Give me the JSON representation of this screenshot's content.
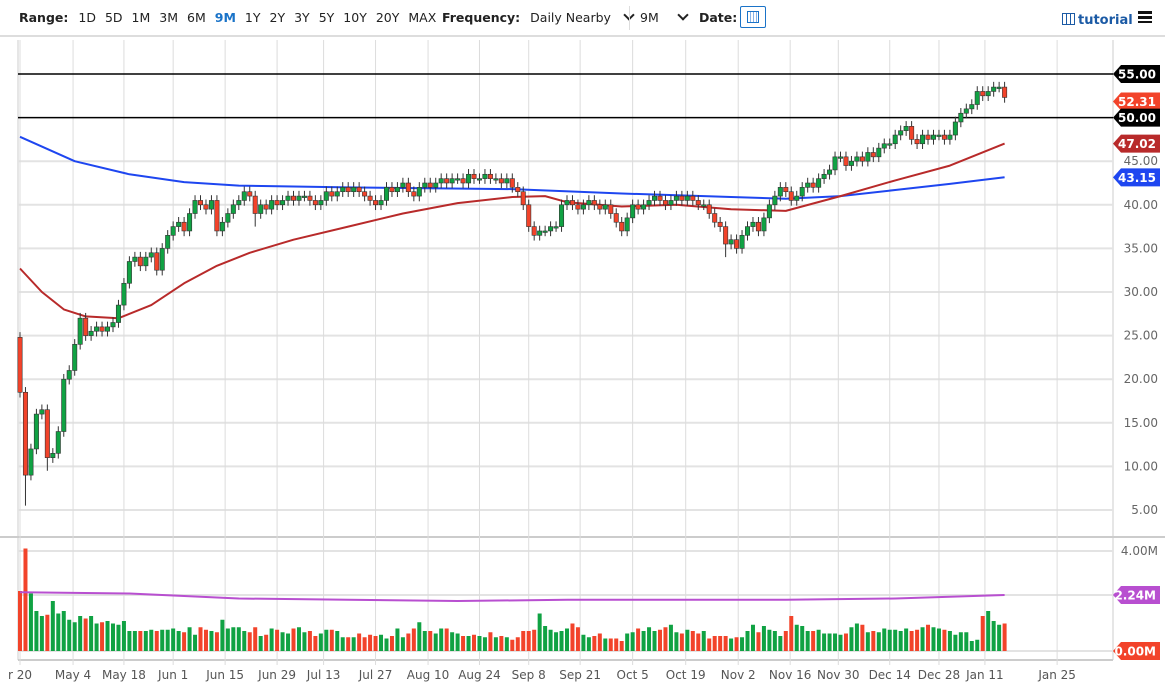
{
  "toolbar": {
    "range_label": "Range:",
    "ranges": [
      "1D",
      "5D",
      "1M",
      "3M",
      "6M",
      "9M",
      "1Y",
      "2Y",
      "3Y",
      "5Y",
      "10Y",
      "20Y",
      "MAX"
    ],
    "active_range": "9M",
    "frequency_label": "Frequency:",
    "frequency_value": "Daily Nearby",
    "period_value": "9M",
    "date_label": "Date:",
    "tutorial_label": "tutorial",
    "icons": {
      "calendar": "calendar-icon",
      "tutorial": "film-icon",
      "menu": "hamburger-menu-icon"
    }
  },
  "colors": {
    "up": "#10a243",
    "down": "#f2432a",
    "ma50": "#b82a2a",
    "ma200": "#1e46f0",
    "vol_ma": "#b84fd0",
    "level": "#000000",
    "last": "#f2432a"
  },
  "chart_data": {
    "type": "candlestick",
    "price_axis": {
      "range": [
        3,
        58
      ],
      "ticks": [
        5,
        10,
        15,
        20,
        25,
        30,
        35,
        40,
        45
      ],
      "grid": true
    },
    "volume_axis": {
      "range": [
        0,
        4.5
      ],
      "ticks": [
        "4.00M"
      ],
      "unit": "M"
    },
    "x_ticks": [
      {
        "label": "r 20",
        "index": 0
      },
      {
        "label": "May 4",
        "index": 9.7
      },
      {
        "label": "May 18",
        "index": 19
      },
      {
        "label": "Jun 1",
        "index": 28
      },
      {
        "label": "Jun 15",
        "index": 37.5
      },
      {
        "label": "Jun 29",
        "index": 47
      },
      {
        "label": "Jul 13",
        "index": 55.5
      },
      {
        "label": "Jul 27",
        "index": 65
      },
      {
        "label": "Aug 10",
        "index": 74.6
      },
      {
        "label": "Aug 24",
        "index": 84
      },
      {
        "label": "Sep 8",
        "index": 93
      },
      {
        "label": "Sep 21",
        "index": 102.4
      },
      {
        "label": "Oct 5",
        "index": 112
      },
      {
        "label": "Oct 19",
        "index": 121.7
      },
      {
        "label": "Nov 2",
        "index": 131.3
      },
      {
        "label": "Nov 16",
        "index": 140.8
      },
      {
        "label": "Nov 30",
        "index": 149.6
      },
      {
        "label": "Dec 14",
        "index": 159
      },
      {
        "label": "Dec 28",
        "index": 168
      },
      {
        "label": "Jan 11",
        "index": 176.4
      },
      {
        "label": "Jan 25",
        "index": 189.6
      }
    ],
    "first_open": 24.8,
    "close": [
      18.5,
      9,
      12,
      16,
      16.5,
      11,
      11.5,
      14,
      20,
      21,
      24,
      27,
      25,
      25.5,
      26,
      25.5,
      26,
      26.5,
      28.5,
      31,
      33.5,
      34,
      33,
      34,
      34.5,
      32.5,
      35,
      36.5,
      37.5,
      38,
      37,
      39,
      40.5,
      40,
      39.5,
      40.5,
      37,
      38,
      39,
      40,
      40.5,
      41.5,
      41,
      39,
      40,
      39.5,
      40.5,
      40,
      40.5,
      41,
      40.5,
      41,
      41,
      40.5,
      40,
      40.5,
      41.5,
      41,
      41.5,
      42,
      41.5,
      42,
      41.5,
      41,
      40.5,
      40,
      40.5,
      42,
      41.5,
      42,
      42.5,
      41.5,
      41,
      42,
      42.5,
      42,
      42.5,
      43,
      42.5,
      43,
      43,
      42.5,
      43.5,
      43,
      43,
      43.5,
      43,
      43,
      42.5,
      43,
      42,
      41.5,
      40,
      37.5,
      36.5,
      37,
      37,
      37.5,
      37.5,
      40,
      40.5,
      40,
      39.5,
      40,
      40.5,
      40,
      39.5,
      40,
      39,
      38,
      37,
      38.5,
      40,
      39.5,
      40,
      40.5,
      41,
      40.5,
      40,
      40.5,
      41,
      40.5,
      41,
      40.5,
      40,
      40,
      39,
      38,
      37.5,
      35.5,
      36,
      35,
      36.5,
      37.5,
      38,
      37,
      38.5,
      40,
      41,
      42,
      41.5,
      40.5,
      41,
      42,
      42.5,
      42,
      43,
      43.5,
      44,
      45.5,
      45.5,
      44.5,
      45,
      45.5,
      45,
      46,
      45.5,
      46.5,
      47,
      47,
      48,
      48.5,
      49,
      47.5,
      47,
      48,
      47.5,
      48,
      48,
      47.5,
      48,
      49.5,
      50.5,
      51,
      51.5,
      53,
      52.5,
      53,
      53.5,
      53.5,
      52.31
    ],
    "wick_pad": 0.6,
    "low_overrides": {
      "1": 5.5,
      "5": 9.5,
      "43": 37.5,
      "129": 34
    },
    "volume": [
      2.4,
      4.1,
      2.3,
      1.6,
      1.4,
      1.45,
      2.0,
      1.5,
      1.6,
      1.25,
      1.15,
      1.4,
      1.3,
      1.4,
      1.1,
      1.15,
      1.2,
      1.1,
      1.05,
      1.2,
      0.8,
      0.8,
      0.8,
      0.8,
      0.85,
      0.8,
      0.85,
      0.85,
      0.9,
      0.8,
      0.75,
      0.95,
      0.65,
      0.95,
      0.85,
      0.8,
      0.75,
      1.25,
      0.9,
      0.95,
      0.95,
      0.8,
      0.75,
      0.95,
      0.6,
      0.65,
      0.9,
      0.85,
      0.75,
      0.7,
      0.9,
      0.95,
      0.75,
      0.8,
      0.6,
      0.7,
      0.85,
      0.85,
      0.8,
      0.55,
      0.55,
      0.55,
      0.7,
      0.55,
      0.65,
      0.6,
      0.65,
      0.5,
      0.6,
      0.9,
      0.55,
      0.7,
      0.9,
      1.15,
      0.8,
      0.8,
      0.7,
      0.9,
      0.9,
      0.75,
      0.7,
      0.6,
      0.6,
      0.65,
      0.6,
      0.55,
      0.75,
      0.55,
      0.6,
      0.55,
      0.45,
      0.55,
      0.8,
      0.8,
      0.85,
      1.5,
      1.0,
      0.85,
      0.75,
      0.8,
      0.9,
      1.1,
      0.95,
      0.65,
      0.55,
      0.6,
      0.7,
      0.5,
      0.5,
      0.5,
      0.4,
      0.7,
      0.75,
      0.9,
      0.8,
      0.95,
      0.8,
      0.85,
      0.95,
      1.05,
      0.75,
      0.7,
      0.85,
      0.8,
      0.7,
      0.8,
      0.5,
      0.6,
      0.6,
      0.6,
      0.5,
      0.55,
      0.55,
      0.8,
      1.05,
      0.75,
      1.0,
      0.85,
      0.8,
      0.6,
      0.8,
      1.4,
      1.05,
      1.0,
      0.8,
      0.8,
      0.85,
      0.7,
      0.7,
      0.7,
      0.65,
      0.7,
      0.95,
      1.1,
      1.05,
      0.75,
      0.8,
      0.75,
      0.9,
      0.85,
      0.85,
      0.8,
      0.9,
      0.8,
      0.85,
      0.95,
      1.05,
      0.95,
      0.9,
      0.85,
      0.8,
      0.65,
      0.75,
      0.75,
      0.4,
      0.45,
      1.4,
      1.6,
      1.2,
      1.05,
      1.1
    ],
    "ma50": {
      "index": [
        0,
        4,
        8,
        12,
        18,
        24,
        30,
        36,
        42,
        50,
        60,
        70,
        80,
        90,
        96,
        100,
        110,
        120,
        130,
        140,
        150,
        160,
        170,
        180
      ],
      "value": [
        32.7,
        30,
        28,
        27.2,
        27,
        28.5,
        31,
        33,
        34.5,
        36,
        37.5,
        39,
        40.2,
        40.9,
        41,
        40.3,
        39.8,
        40,
        39.5,
        39.3,
        41,
        42.8,
        44.5,
        47.02
      ]
    },
    "ma200": {
      "index": [
        0,
        10,
        20,
        30,
        40,
        60,
        90,
        110,
        130,
        140,
        150,
        160,
        170,
        180
      ],
      "value": [
        47.8,
        45,
        43.5,
        42.6,
        42.2,
        42,
        41.8,
        41.3,
        40.9,
        40.7,
        41,
        41.7,
        42.4,
        43.15
      ]
    },
    "vol_ma": {
      "index": [
        0,
        20,
        40,
        60,
        80,
        100,
        120,
        140,
        160,
        180
      ],
      "value": [
        2.35,
        2.3,
        2.1,
        2.05,
        2.0,
        2.05,
        2.05,
        2.05,
        2.1,
        2.24
      ]
    },
    "levels": [
      55,
      50
    ],
    "badges": [
      {
        "label": "55.00",
        "value": 55,
        "color": "#000000"
      },
      {
        "label": "52.31",
        "value": 52.31,
        "color": "#f2432a"
      },
      {
        "label": "50.00",
        "value": 50,
        "color": "#000000"
      },
      {
        "label": "47.02",
        "value": 47.02,
        "color": "#b82a2a"
      },
      {
        "label": "43.15",
        "value": 43.15,
        "color": "#1e46f0"
      }
    ],
    "volume_badges": [
      {
        "label": "2.24M",
        "value": 2.24,
        "color": "#b84fd0"
      },
      {
        "label": "0.00M",
        "value": 0,
        "color": "#f2432a"
      }
    ]
  }
}
